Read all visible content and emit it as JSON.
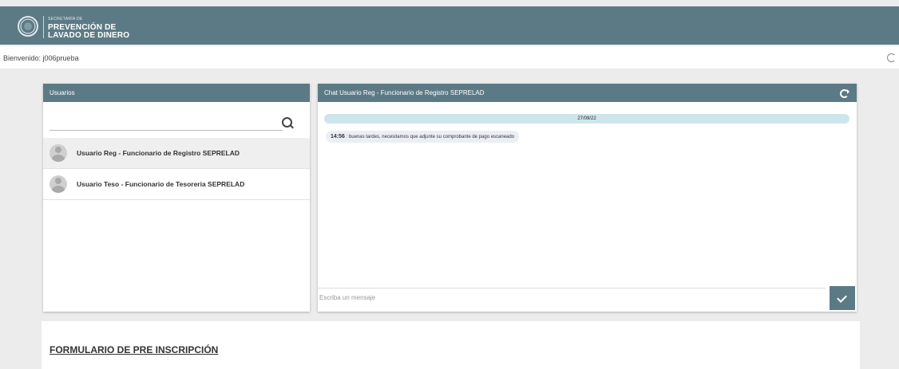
{
  "header": {
    "logo_small": "SECRETARÍA DE",
    "logo_line1": "PREVENCIÓN DE",
    "logo_line2": "LAVADO DE DINERO"
  },
  "welcome": {
    "text": "Bienvenido: j006prueba"
  },
  "users_panel": {
    "title": "Usuarios",
    "search_placeholder": "",
    "users": [
      {
        "name": "Usuario Reg - Funcionario de Registro SEPRELAD",
        "active": true
      },
      {
        "name": "Usuario Teso - Funcionario de Tesoreria SEPRELAD",
        "active": false
      }
    ]
  },
  "chat_panel": {
    "title": "Chat Usuario Reg - Funcionario de Registro SEPRELAD",
    "date": "27/09/22",
    "messages": [
      {
        "time": "14:56",
        "text": " : buenas tardes, necesitamos que adjunte su comprobante de pago escaneado"
      }
    ],
    "input_placeholder": "Escriba un mensaje"
  },
  "form": {
    "title": "FORMULARIO DE PRE INSCRIPCIÓN"
  },
  "colors": {
    "primary": "#5c7a85",
    "date_pill": "#cde6ec",
    "background": "#ececec"
  }
}
